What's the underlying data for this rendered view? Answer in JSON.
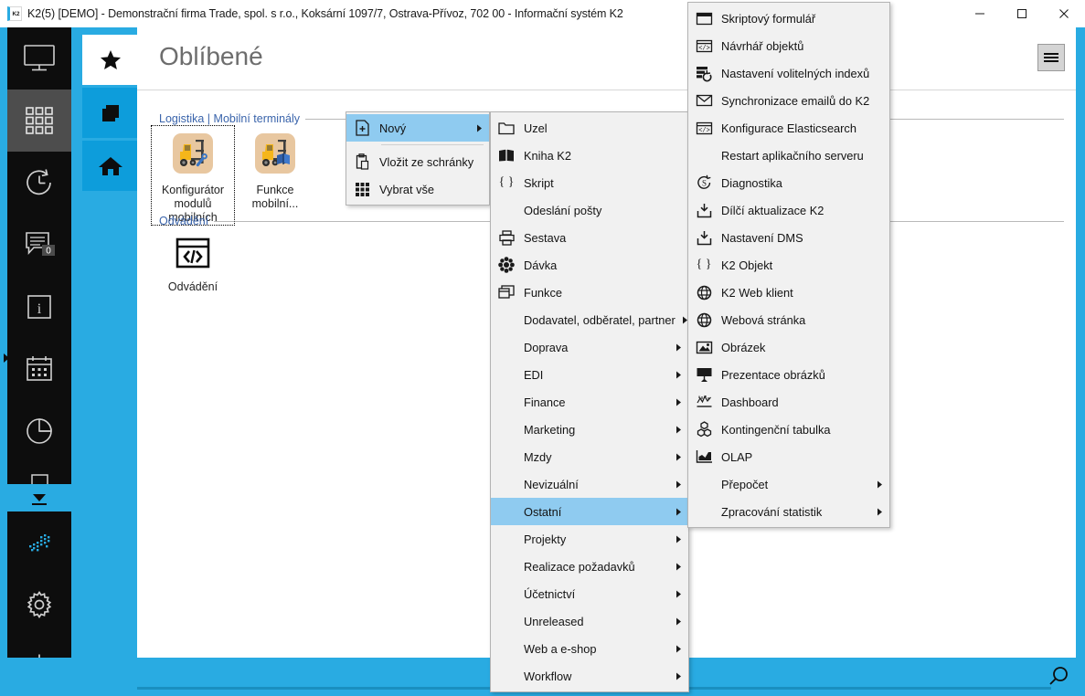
{
  "window": {
    "title": "K2(5) [DEMO] - Demonstrační firma Trade, spol. s r.o., Koksární 1097/7, Ostrava-Přívoz, 702 00 - Informační systém K2",
    "app_badge": "K2",
    "minimize_label": "Minimalizovat",
    "maximize_label": "Maximalizovat",
    "close_label": "Zavřít",
    "hamburger_label": "Menu"
  },
  "colors": {
    "accent": "#29abe2",
    "accent_dark": "#0d9ddb",
    "rail_bg": "#0d0d0d",
    "rail_active": "#4d4d4d",
    "menu_bg": "#f1f1f1",
    "menu_highlight": "#8fcbf0",
    "group_header": "#3a64ab",
    "title_grey": "#6d6d6d"
  },
  "rail": {
    "items": [
      {
        "name": "monitor-icon",
        "label": "Plocha"
      },
      {
        "name": "grid-icon",
        "label": "Moduly",
        "active": true
      },
      {
        "name": "clock-history-icon",
        "label": "Historie"
      },
      {
        "name": "messages-icon",
        "label": "Zprávy",
        "badge": "0"
      },
      {
        "name": "info-icon",
        "label": "Informace"
      },
      {
        "name": "calendar-icon",
        "label": "Kalendář"
      },
      {
        "name": "pie-chart-icon",
        "label": "Statistiky"
      },
      {
        "name": "monitor-download-icon",
        "label": "Stahování"
      }
    ],
    "collapse_label": "Sbalit",
    "bottom_items": [
      {
        "name": "sparkle-icon",
        "label": "Novinky"
      },
      {
        "name": "gear-icon",
        "label": "Nastavení"
      },
      {
        "name": "power-icon",
        "label": "Odhlásit"
      }
    ]
  },
  "blue_rail": {
    "items": [
      {
        "name": "star-icon",
        "label": "Oblíbené",
        "active": true
      },
      {
        "name": "copy-icon",
        "label": "Kopie"
      },
      {
        "name": "home-icon",
        "label": "Domů"
      }
    ]
  },
  "main": {
    "page_title": "Oblíbené",
    "groups": [
      {
        "header": "Logistika | Mobilní terminály",
        "tiles": [
          {
            "label": "Konfigurátor\nmodulů\nmobilních",
            "icon": "forklift-wrench-icon",
            "selected": true
          },
          {
            "label": "Funkce\nmobilní...",
            "icon": "forklift-book-icon",
            "selected": false
          }
        ]
      },
      {
        "header": "Odvádění",
        "tiles": [
          {
            "label": "Odvádění",
            "icon": "code-window-icon",
            "selected": false
          }
        ]
      }
    ]
  },
  "statusbar": {
    "search_label": "Hledat"
  },
  "menus": {
    "context": {
      "items": [
        {
          "label": "Nový",
          "icon": "new-document-icon",
          "submenu": true,
          "highlighted": true
        },
        {
          "label": "Vložit ze schránky",
          "icon": "clipboard-paste-icon",
          "submenu": false,
          "highlighted": false
        },
        {
          "label": "Vybrat vše",
          "icon": "select-all-grid-icon",
          "submenu": false,
          "highlighted": false
        }
      ]
    },
    "novy": {
      "items": [
        {
          "label": "Uzel",
          "icon": "folder-icon",
          "submenu": false,
          "highlighted": false
        },
        {
          "label": "Kniha K2",
          "icon": "book-icon",
          "submenu": false,
          "highlighted": false
        },
        {
          "label": "Skript",
          "icon": "braces-icon",
          "submenu": false,
          "highlighted": false
        },
        {
          "label": "Odeslání pošty",
          "icon": "",
          "submenu": false,
          "highlighted": false
        },
        {
          "label": "Sestava",
          "icon": "printer-icon",
          "submenu": false,
          "highlighted": false
        },
        {
          "label": "Dávka",
          "icon": "batch-icon",
          "submenu": false,
          "highlighted": false
        },
        {
          "label": "Funkce",
          "icon": "window-icon",
          "submenu": false,
          "highlighted": false
        },
        {
          "label": "Dodavatel, odběratel, partner",
          "icon": "",
          "submenu": true,
          "highlighted": false
        },
        {
          "label": "Doprava",
          "icon": "",
          "submenu": true,
          "highlighted": false
        },
        {
          "label": "EDI",
          "icon": "",
          "submenu": true,
          "highlighted": false
        },
        {
          "label": "Finance",
          "icon": "",
          "submenu": true,
          "highlighted": false
        },
        {
          "label": "Marketing",
          "icon": "",
          "submenu": true,
          "highlighted": false
        },
        {
          "label": "Mzdy",
          "icon": "",
          "submenu": true,
          "highlighted": false
        },
        {
          "label": "Nevizuální",
          "icon": "",
          "submenu": true,
          "highlighted": false
        },
        {
          "label": "Ostatní",
          "icon": "",
          "submenu": true,
          "highlighted": true
        },
        {
          "label": "Projekty",
          "icon": "",
          "submenu": true,
          "highlighted": false
        },
        {
          "label": "Realizace požadavků",
          "icon": "",
          "submenu": true,
          "highlighted": false
        },
        {
          "label": "Účetnictví",
          "icon": "",
          "submenu": true,
          "highlighted": false
        },
        {
          "label": "Unreleased",
          "icon": "",
          "submenu": true,
          "highlighted": false
        },
        {
          "label": "Web a e-shop",
          "icon": "",
          "submenu": true,
          "highlighted": false
        },
        {
          "label": "Workflow",
          "icon": "",
          "submenu": true,
          "highlighted": false
        }
      ]
    },
    "ostatni": {
      "items": [
        {
          "label": "Skriptový formulář",
          "icon": "form-window-icon",
          "submenu": false,
          "highlighted": false
        },
        {
          "label": "Návrhář objektů",
          "icon": "code-window-icon",
          "submenu": false,
          "highlighted": false
        },
        {
          "label": "Nastavení volitelných indexů",
          "icon": "index-settings-icon",
          "submenu": false,
          "highlighted": false
        },
        {
          "label": "Synchronizace emailů do K2",
          "icon": "envelope-icon",
          "submenu": false,
          "highlighted": false
        },
        {
          "label": "Konfigurace Elasticsearch",
          "icon": "code-window-icon",
          "submenu": false,
          "highlighted": false
        },
        {
          "label": "Restart aplikačního serveru",
          "icon": "",
          "submenu": false,
          "highlighted": false
        },
        {
          "label": "Diagnostika",
          "icon": "diagnostics-icon",
          "submenu": false,
          "highlighted": false
        },
        {
          "label": "Dílčí aktualizace K2",
          "icon": "download-box-icon",
          "submenu": false,
          "highlighted": false
        },
        {
          "label": "Nastavení DMS",
          "icon": "download-box-icon",
          "submenu": false,
          "highlighted": false
        },
        {
          "label": "K2 Objekt",
          "icon": "braces-icon",
          "submenu": false,
          "highlighted": false
        },
        {
          "label": "K2 Web klient",
          "icon": "globe-icon",
          "submenu": false,
          "highlighted": false
        },
        {
          "label": "Webová stránka",
          "icon": "globe-icon",
          "submenu": false,
          "highlighted": false
        },
        {
          "label": "Obrázek",
          "icon": "image-icon",
          "submenu": false,
          "highlighted": false
        },
        {
          "label": "Prezentace obrázků",
          "icon": "presentation-icon",
          "submenu": false,
          "highlighted": false
        },
        {
          "label": "Dashboard",
          "icon": "dashboard-icon",
          "submenu": false,
          "highlighted": false
        },
        {
          "label": "Kontingenční tabulka",
          "icon": "pivot-table-icon",
          "submenu": false,
          "highlighted": false
        },
        {
          "label": "OLAP",
          "icon": "olap-chart-icon",
          "submenu": false,
          "highlighted": false
        },
        {
          "label": "Přepočet",
          "icon": "",
          "submenu": true,
          "highlighted": false
        },
        {
          "label": "Zpracování statistik",
          "icon": "",
          "submenu": true,
          "highlighted": false
        }
      ]
    }
  }
}
